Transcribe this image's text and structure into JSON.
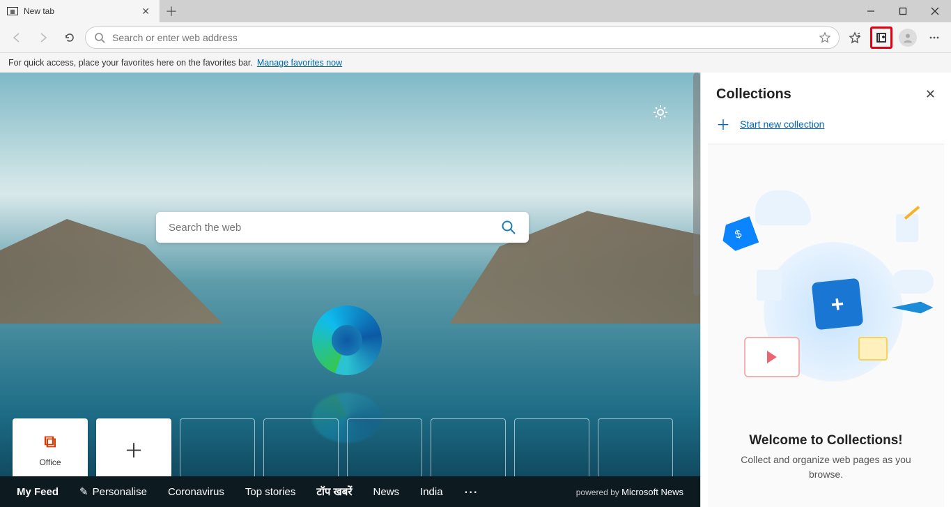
{
  "tab": {
    "title": "New tab"
  },
  "toolbar": {
    "address_placeholder": "Search or enter web address"
  },
  "favbar": {
    "hint": "For quick access, place your favorites here on the favorites bar.",
    "manage_link": "Manage favorites now"
  },
  "ntp": {
    "search_placeholder": "Search the web",
    "topsites": {
      "office_label": "Office"
    },
    "feedbar": {
      "myfeed": "My Feed",
      "personalise": "Personalise",
      "links": [
        "Coronavirus",
        "Top stories",
        "टॉप खबरें",
        "News",
        "India"
      ],
      "powered_prefix": "powered by",
      "powered_brand": "Microsoft News"
    }
  },
  "collections": {
    "title": "Collections",
    "start_new": "Start new collection",
    "welcome_heading": "Welcome to Collections!",
    "welcome_body": "Collect and organize web pages as you browse."
  }
}
